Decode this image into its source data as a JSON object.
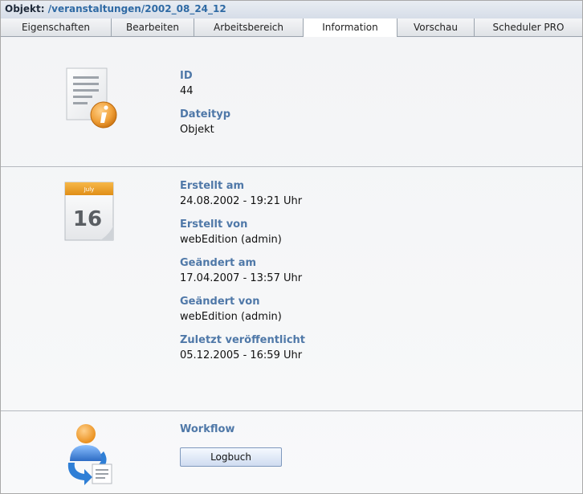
{
  "header": {
    "label": "Objekt:",
    "path": "/veranstaltungen/2002_08_24_12"
  },
  "tabs": [
    {
      "label": "Eigenschaften",
      "active": false
    },
    {
      "label": "Bearbeiten",
      "active": false
    },
    {
      "label": "Arbeitsbereich",
      "active": false
    },
    {
      "label": "Information",
      "active": true
    },
    {
      "label": "Vorschau",
      "active": false
    },
    {
      "label": "Scheduler PRO",
      "active": false
    }
  ],
  "info": {
    "icon": "document-info-icon",
    "id_label": "ID",
    "id_value": "44",
    "type_label": "Dateityp",
    "type_value": "Objekt"
  },
  "dates": {
    "icon": "calendar-icon",
    "calendar_month": "July",
    "calendar_day": "16",
    "created_label": "Erstellt am",
    "created_value": "24.08.2002 - 19:21 Uhr",
    "created_by_label": "Erstellt von",
    "created_by_value": "webEdition (admin)",
    "changed_label": "Geändert am",
    "changed_value": "17.04.2007 - 13:57 Uhr",
    "changed_by_label": "Geändert von",
    "changed_by_value": "webEdition (admin)",
    "published_label": "Zuletzt veröffentlicht",
    "published_value": "05.12.2005 - 16:59 Uhr"
  },
  "workflow": {
    "icon": "workflow-user-icon",
    "label": "Workflow",
    "button_label": "Logbuch"
  },
  "colors": {
    "label_blue": "#4f78a8",
    "path_blue": "#2f6aa4",
    "calendar_orange": "#f0a023",
    "info_orange": "#e8921c"
  }
}
